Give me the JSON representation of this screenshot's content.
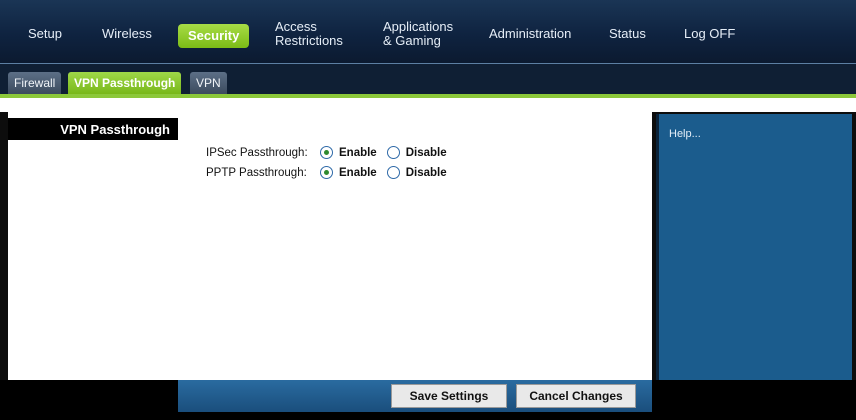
{
  "nav": {
    "setup": "Setup",
    "wireless": "Wireless",
    "security": "Security",
    "access_line1": "Access",
    "access_line2": "Restrictions",
    "apps_line1": "Applications",
    "apps_line2": "& Gaming",
    "administration": "Administration",
    "status": "Status",
    "logoff": "Log OFF"
  },
  "subtabs": {
    "firewall": "Firewall",
    "vpn_passthrough": "VPN Passthrough",
    "vpn": "VPN"
  },
  "section_title": "VPN Passthrough",
  "settings": [
    {
      "label": "IPSec Passthrough:",
      "enable": "Enable",
      "disable": "Disable",
      "selected": "Enable"
    },
    {
      "label": "PPTP Passthrough:",
      "enable": "Enable",
      "disable": "Disable",
      "selected": "Enable"
    }
  ],
  "help": "Help...",
  "buttons": {
    "save": "Save Settings",
    "cancel": "Cancel Changes"
  },
  "colors": {
    "accent_green": "#8cc83a",
    "help_panel": "#1b5c8d",
    "nav_bg": "#0f2340"
  }
}
